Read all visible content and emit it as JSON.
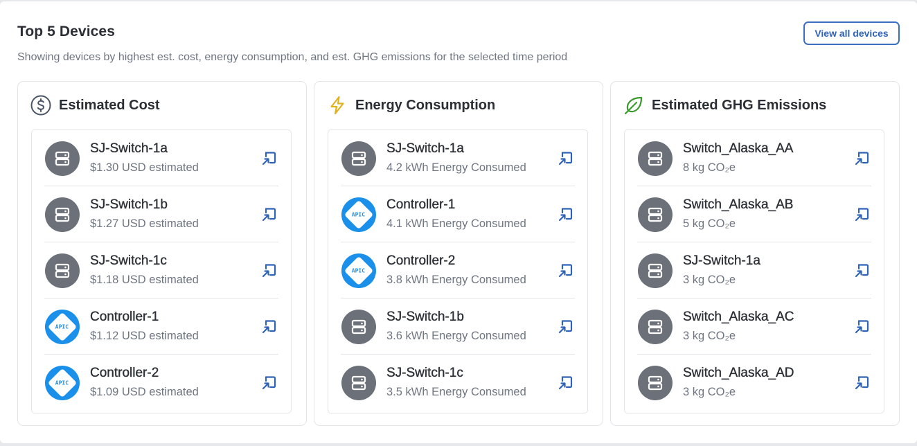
{
  "header": {
    "title": "Top 5 Devices",
    "subtitle": "Showing devices by highest est. cost, energy consumption, and est. GHG emissions for the selected time period",
    "view_all_label": "View all devices"
  },
  "colors": {
    "accent": "#2f63b8",
    "switch_avatar": "#6b7079",
    "apic_avatar": "#1a90ea",
    "cost_icon": "#4a5566",
    "energy_icon": "#e2b21c",
    "ghg_icon": "#3a9a2c"
  },
  "cards": [
    {
      "title": "Estimated Cost",
      "icon": "dollar-circle-icon",
      "devices": [
        {
          "name": "SJ-Switch-1a",
          "metric": "$1.30 USD estimated",
          "type": "switch"
        },
        {
          "name": "SJ-Switch-1b",
          "metric": "$1.27 USD estimated",
          "type": "switch"
        },
        {
          "name": "SJ-Switch-1c",
          "metric": "$1.18 USD estimated",
          "type": "switch"
        },
        {
          "name": "Controller-1",
          "metric": "$1.12 USD estimated",
          "type": "apic"
        },
        {
          "name": "Controller-2",
          "metric": "$1.09 USD estimated",
          "type": "apic"
        }
      ]
    },
    {
      "title": "Energy Consumption",
      "icon": "lightning-bolt-icon",
      "devices": [
        {
          "name": "SJ-Switch-1a",
          "metric": "4.2 kWh Energy Consumed",
          "type": "switch"
        },
        {
          "name": "Controller-1",
          "metric": "4.1 kWh Energy Consumed",
          "type": "apic"
        },
        {
          "name": "Controller-2",
          "metric": "3.8 kWh Energy Consumed",
          "type": "apic"
        },
        {
          "name": "SJ-Switch-1b",
          "metric": "3.6 kWh Energy Consumed",
          "type": "switch"
        },
        {
          "name": "SJ-Switch-1c",
          "metric": "3.5 kWh Energy Consumed",
          "type": "switch"
        }
      ]
    },
    {
      "title": "Estimated GHG Emissions",
      "icon": "leaf-icon",
      "devices": [
        {
          "name": "Switch_Alaska_AA",
          "metric": "8 kg CO₂e",
          "type": "switch"
        },
        {
          "name": "Switch_Alaska_AB",
          "metric": "5 kg CO₂e",
          "type": "switch"
        },
        {
          "name": "SJ-Switch-1a",
          "metric": "3 kg CO₂e",
          "type": "switch"
        },
        {
          "name": "Switch_Alaska_AC",
          "metric": "3 kg CO₂e",
          "type": "switch"
        },
        {
          "name": "Switch_Alaska_AD",
          "metric": "3 kg CO₂e",
          "type": "switch"
        }
      ]
    }
  ],
  "apic_label": "APIC"
}
